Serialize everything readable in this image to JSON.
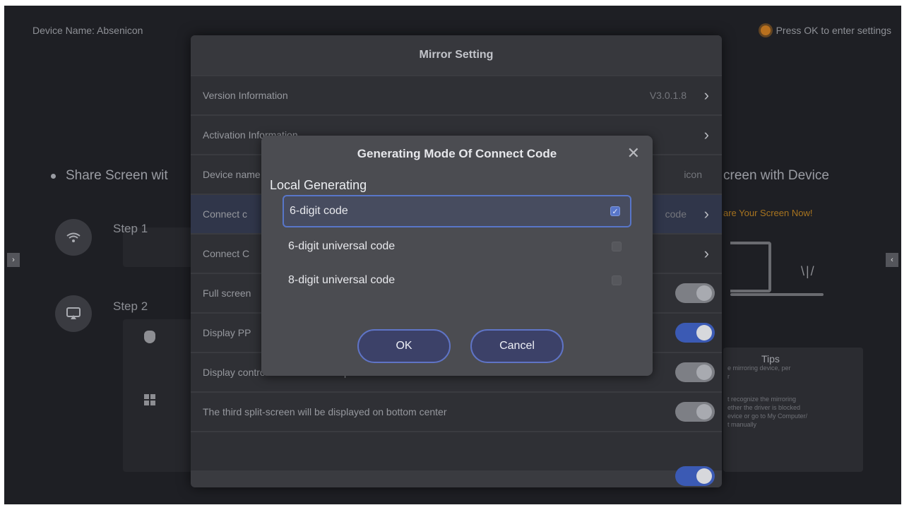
{
  "home": {
    "device_name": "Device Name: Absenicon",
    "settings_hint": "Press OK to enter settings",
    "share_left": "Share Screen wit",
    "share_right": "creen with Device",
    "share_now": "are Your Screen Now!",
    "step1": "Step  1",
    "step2": "Step  2",
    "tips_title": "Tips",
    "tips_lines": [
      "e mirroring device, per",
      "r",
      "t recognize the mirroring",
      "ether the driver is blocked",
      "evice or go to My Computer/",
      "t manually"
    ],
    "nav_left": "›",
    "nav_right": "‹"
  },
  "mirror": {
    "title": "Mirror Setting",
    "rows": [
      {
        "label": "Version Information",
        "value": "V3.0.1.8",
        "control": "chevron"
      },
      {
        "label": "Activation Information",
        "value": "",
        "control": "chevron"
      },
      {
        "label": "Device name",
        "value": "icon",
        "control": "none"
      },
      {
        "label": "Connect c",
        "value": "code",
        "control": "chevron"
      },
      {
        "label": "Connect C",
        "value": "",
        "control": "chevron"
      },
      {
        "label": "Full screen",
        "value": "",
        "control": "toggle-off"
      },
      {
        "label": "Display PP",
        "value": "",
        "control": "toggle-on"
      },
      {
        "label": "Display control bar under multi split-screen mode",
        "value": "",
        "control": "toggle-off"
      },
      {
        "label": "The third split-screen will be displayed on bottom center",
        "value": "",
        "control": "toggle-off"
      }
    ],
    "chevron_glyph": "›"
  },
  "dialog": {
    "title": "Generating Mode Of Connect Code",
    "close_glyph": "✕",
    "section": "Local Generating",
    "options": [
      {
        "label": "6-digit code",
        "checked": true
      },
      {
        "label": "6-digit universal code",
        "checked": false
      },
      {
        "label": "8-digit universal code",
        "checked": false
      }
    ],
    "check_glyph": "✓",
    "ok_label": "OK",
    "cancel_label": "Cancel"
  },
  "colors": {
    "accent": "#5876c9",
    "toggle_on": "#3b5ab4",
    "hint_orange": "#b8701e"
  }
}
